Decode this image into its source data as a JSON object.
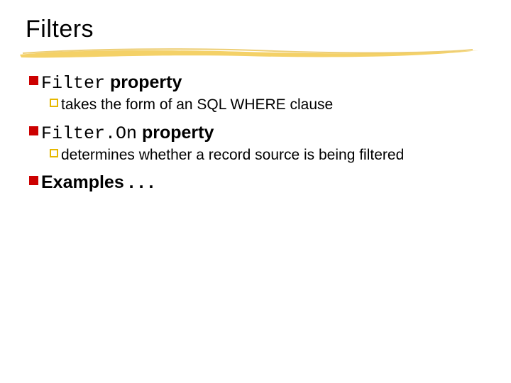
{
  "title": "Filters",
  "items": [
    {
      "code": "Filter",
      "rest": " property",
      "sub": [
        {
          "text": "takes the form of an SQL WHERE clause"
        }
      ]
    },
    {
      "code": "Filter.On",
      "rest": " property",
      "sub": [
        {
          "text": "determines whether a record source is being filtered"
        }
      ]
    },
    {
      "code": "",
      "rest": "Examples . . .",
      "sub": []
    }
  ]
}
